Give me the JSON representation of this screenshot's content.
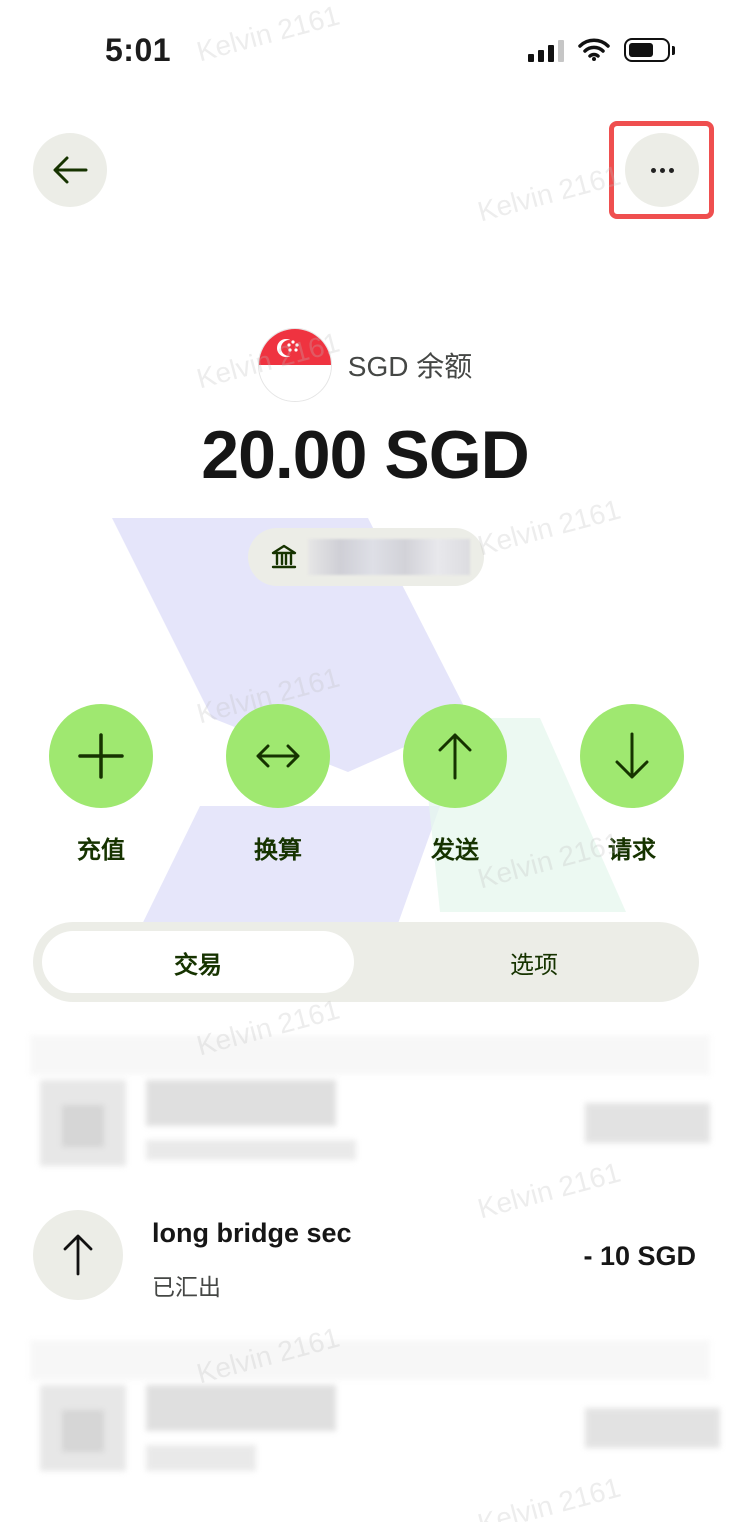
{
  "status_bar": {
    "time": "5:01"
  },
  "nav": {
    "back_icon": "arrow-left-icon",
    "more_icon": "more-horizontal-icon"
  },
  "balance": {
    "label": "SGD 余额",
    "amount": "20.00 SGD",
    "flag_icon": "singapore-flag-icon",
    "bank_icon": "bank-icon"
  },
  "actions": [
    {
      "label": "充值",
      "icon": "plus-icon"
    },
    {
      "label": "换算",
      "icon": "swap-arrows-icon"
    },
    {
      "label": "发送",
      "icon": "arrow-up-icon"
    },
    {
      "label": "请求",
      "icon": "arrow-down-icon"
    }
  ],
  "tabs": {
    "active": "交易",
    "inactive": "选项"
  },
  "transactions": [
    {
      "name": "long bridge sec",
      "status": "已汇出",
      "amount": "- 10 SGD",
      "icon": "arrow-up-icon"
    }
  ],
  "watermark": "Kelvin 2161",
  "colors": {
    "accent": "#9fe870",
    "accent_text": "#163300",
    "chip_bg": "#ecede7",
    "highlight": "#ef4f4f"
  }
}
